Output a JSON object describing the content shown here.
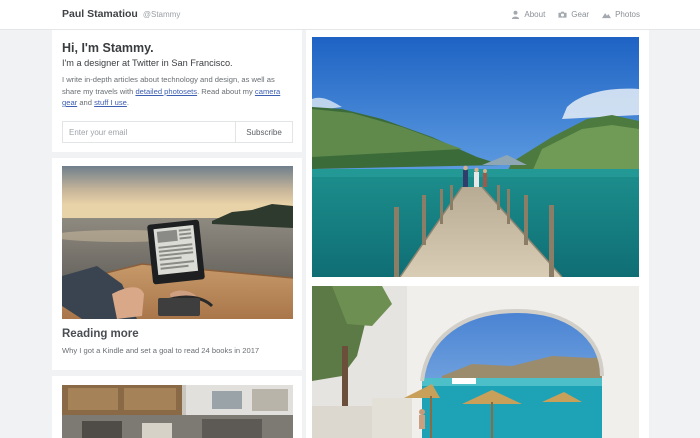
{
  "header": {
    "name": "Paul Stamatiou",
    "handle": "@Stammy",
    "nav": [
      {
        "label": "About",
        "icon": "person-icon"
      },
      {
        "label": "Gear",
        "icon": "camera-icon"
      },
      {
        "label": "Photos",
        "icon": "mountain-icon"
      }
    ]
  },
  "intro": {
    "heading": "Hi, I'm Stammy.",
    "tagline": "I'm a designer at Twitter in San Francisco.",
    "bio_1": "I write in-depth articles about technology and design, as well as share my travels with ",
    "link_photosets": "detailed photosets",
    "bio_2": ". Read about my ",
    "link_gear": "camera gear",
    "bio_3": " and ",
    "link_stuff": "stuff I use",
    "bio_4": "."
  },
  "subscribe": {
    "placeholder": "Enter your email",
    "button": "Subscribe"
  },
  "posts": [
    {
      "title": "Reading more",
      "subtitle": "Why I got a Kindle and set a goal to read 24 books in 2017"
    }
  ]
}
